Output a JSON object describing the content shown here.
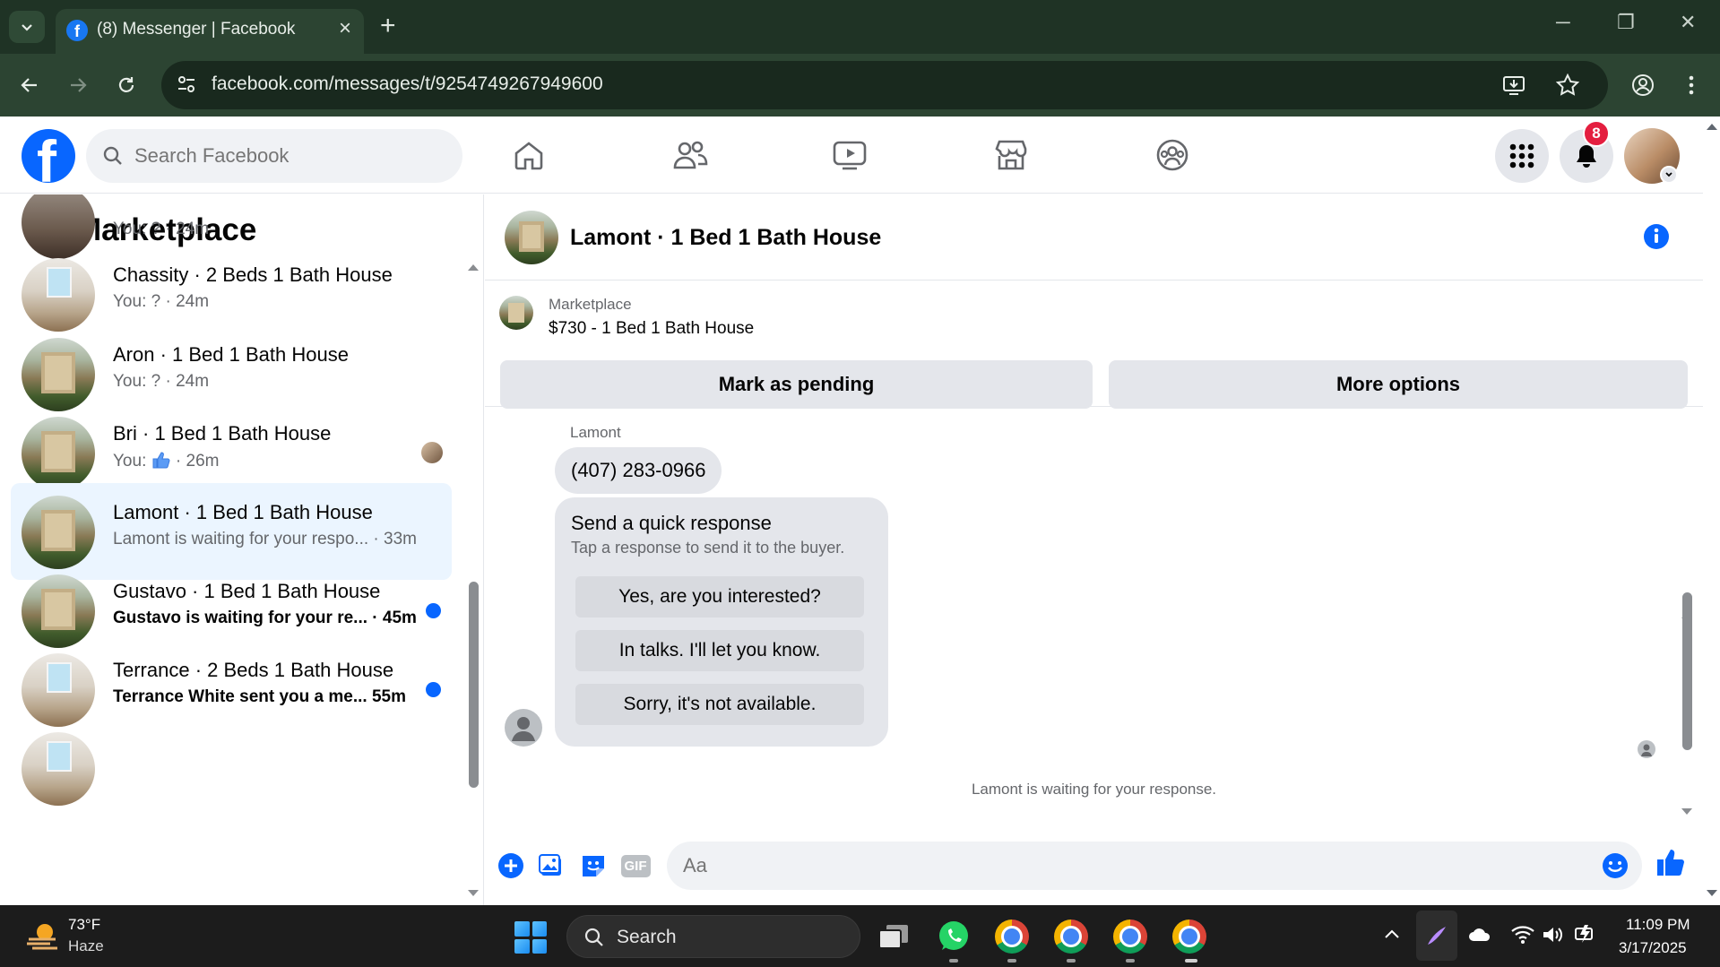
{
  "browser": {
    "tab_title": "(8) Messenger | Facebook",
    "url": "facebook.com/messages/t/9254749267949600"
  },
  "fb_header": {
    "search_placeholder": "Search Facebook",
    "notification_count": "8"
  },
  "sidebar": {
    "title": "Marketplace",
    "conversations": [
      {
        "name": "",
        "sub": "You: ? · 24m",
        "avatar": "room-dark",
        "unread": false,
        "active": false
      },
      {
        "name": "Chassity · 2 Beds 1 Bath House",
        "sub": "You: ? · 24m",
        "avatar": "room",
        "unread": false,
        "active": false
      },
      {
        "name": "Aron · 1 Bed 1 Bath House",
        "sub": "You: ? · 24m",
        "avatar": "house",
        "unread": false,
        "active": false
      },
      {
        "name": "Bri · 1 Bed 1 Bath House",
        "sub_prefix": "You:",
        "sub_suffix": "· 26m",
        "avatar": "house",
        "unread": false,
        "active": false
      },
      {
        "name": "Lamont · 1 Bed 1 Bath House",
        "sub": "Lamont is waiting for your respo...  · 33m",
        "avatar": "house",
        "unread": false,
        "active": true
      },
      {
        "name": "Gustavo · 1 Bed 1 Bath House",
        "sub": "Gustavo is waiting for your re...  · 45m",
        "avatar": "house",
        "unread": true,
        "active": false
      },
      {
        "name": "Terrance · 2 Beds 1 Bath House",
        "sub": "Terrance White sent you a me...  55m",
        "avatar": "room",
        "unread": true,
        "active": false
      }
    ]
  },
  "chat": {
    "title": "Lamont · 1 Bed 1 Bath House",
    "listing_label": "Marketplace",
    "listing_title": "$730 - 1 Bed 1 Bath House",
    "mark_pending_label": "Mark as pending",
    "more_options_label": "More options",
    "sender_name": "Lamont",
    "phone_message": "(407) 283-0966",
    "quick_response": {
      "title": "Send a quick response",
      "subtitle": "Tap a response to send it to the buyer.",
      "options": [
        "Yes, are you interested?",
        "In talks. I'll let you know.",
        "Sorry, it's not available."
      ]
    },
    "waiting_notice": "Lamont is waiting for your response.",
    "composer_placeholder": "Aa",
    "gif_label": "GIF"
  },
  "taskbar": {
    "weather_temp": "73°F",
    "weather_desc": "Haze",
    "search_label": "Search",
    "time": "11:09 PM",
    "date": "3/17/2025"
  },
  "colors": {
    "fb_blue": "#0866ff",
    "active_row": "#ebf5ff",
    "badge_red": "#e41e3f",
    "chrome_frame": "#1f3325"
  }
}
